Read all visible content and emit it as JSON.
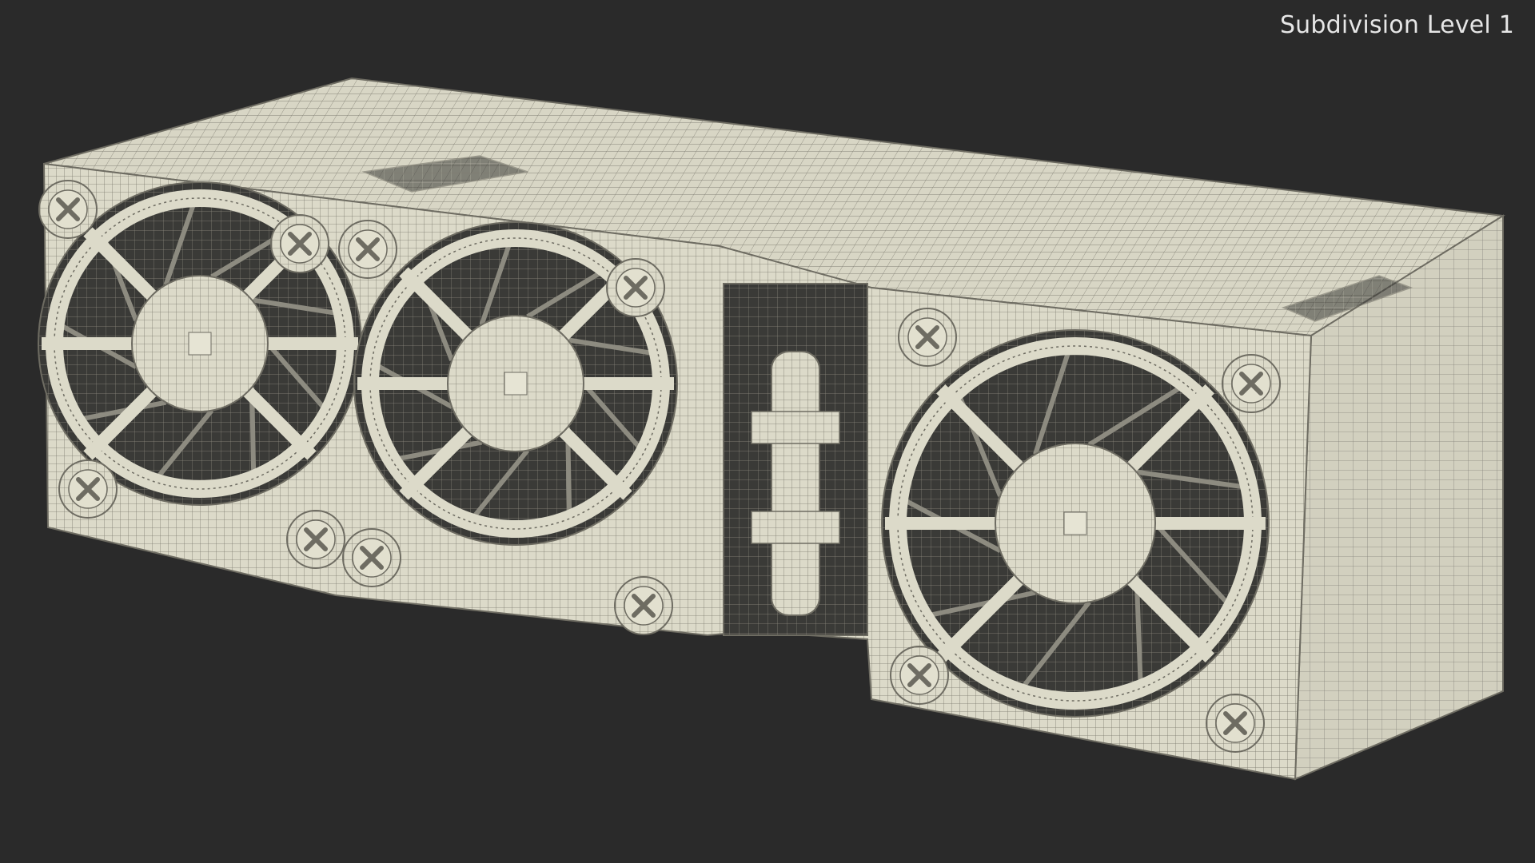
{
  "viewport": {
    "label": "Subdivision Level 1",
    "background": "#2a2a2a",
    "mesh_fill": "#dcdac9",
    "wire_color": "#6e6c62",
    "shadow_color": "#8f8d80"
  },
  "scene": {
    "object": "fan-module-wireframe",
    "fans": [
      {
        "name": "fan-left"
      },
      {
        "name": "fan-middle"
      },
      {
        "name": "fan-right"
      }
    ],
    "screws": 12
  }
}
